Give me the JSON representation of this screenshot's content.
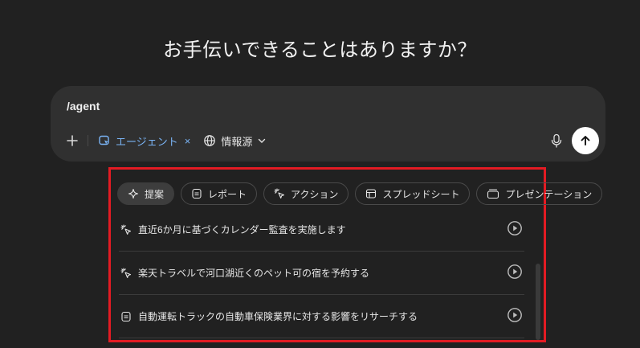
{
  "headline": "お手伝いできることはありますか？",
  "composer": {
    "input_value": "/agent",
    "agent_chip_label": "エージェント",
    "agent_chip_close": "×",
    "sources_label": "情報源"
  },
  "tabs": [
    {
      "label": "提案",
      "icon": "sparkle-icon",
      "active": true
    },
    {
      "label": "レポート",
      "icon": "document-icon",
      "active": false
    },
    {
      "label": "アクション",
      "icon": "cursor-click-icon",
      "active": false
    },
    {
      "label": "スプレッドシート",
      "icon": "table-icon",
      "active": false
    },
    {
      "label": "プレゼンテーション",
      "icon": "slides-icon",
      "active": false
    }
  ],
  "suggestions": [
    {
      "text": "直近6か月に基づくカレンダー監査を実施します",
      "icon": "cursor-click-icon"
    },
    {
      "text": "楽天トラベルで河口湖近くのペット可の宿を予約する",
      "icon": "cursor-click-icon"
    },
    {
      "text": "自動運転トラックの自動車保険業界に対する影響をリサーチする",
      "icon": "document-icon"
    }
  ],
  "colors": {
    "background": "#212121",
    "composer": "#303030",
    "accent": "#7ab4f5",
    "highlight": "#e31b23"
  }
}
